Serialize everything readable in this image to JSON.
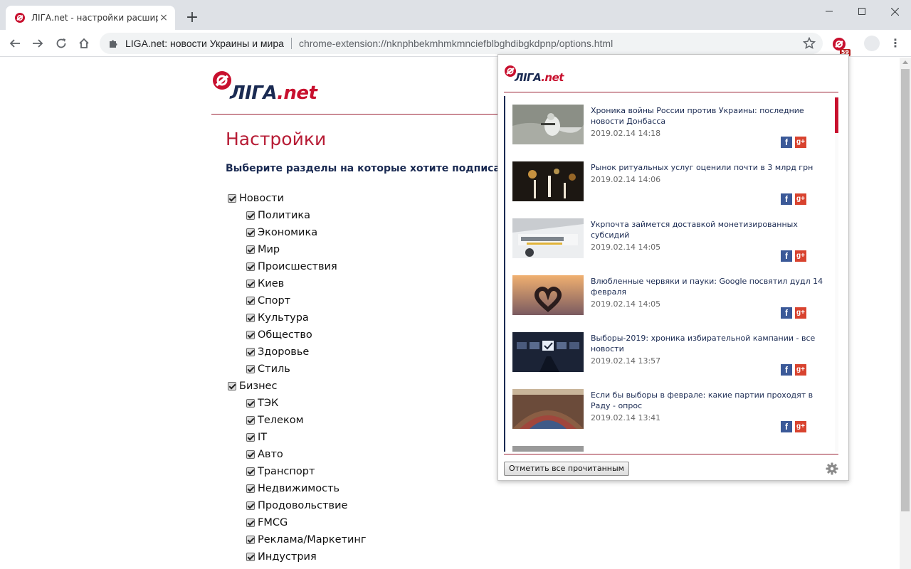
{
  "browser": {
    "tab_title": "ЛІГА.net - настройки расширения",
    "tab_close": "×",
    "new_tab": "+",
    "site_name": "LIGA.net: новости Украины и мира",
    "url": "chrome-extension://nknphbekmhmkmnciefblbghdibgkdpnp/options.html",
    "extension_badge": "59",
    "menu_glyph": "⋮",
    "brand_color": "#c8102e",
    "navy_color": "#1a2a52"
  },
  "logo": {
    "part1": "ЛІГА",
    "part2": ".net"
  },
  "page": {
    "title": "Настройки",
    "prompt": "Выберите разделы на которые хотите подписаться:",
    "sections": [
      {
        "label": "Новости",
        "checked": true,
        "children": [
          {
            "label": "Политика",
            "checked": true
          },
          {
            "label": "Экономика",
            "checked": true
          },
          {
            "label": "Мир",
            "checked": true
          },
          {
            "label": "Происшествия",
            "checked": true
          },
          {
            "label": "Киев",
            "checked": true
          },
          {
            "label": "Спорт",
            "checked": true
          },
          {
            "label": "Культура",
            "checked": true
          },
          {
            "label": "Общество",
            "checked": true
          },
          {
            "label": "Здоровье",
            "checked": true
          },
          {
            "label": "Стиль",
            "checked": true
          }
        ]
      },
      {
        "label": "Бизнес",
        "checked": true,
        "children": [
          {
            "label": "ТЭК",
            "checked": true
          },
          {
            "label": "Телеком",
            "checked": true
          },
          {
            "label": "IT",
            "checked": true
          },
          {
            "label": "Авто",
            "checked": true
          },
          {
            "label": "Транспорт",
            "checked": true
          },
          {
            "label": "Недвижимость",
            "checked": true
          },
          {
            "label": "Продовольствие",
            "checked": true
          },
          {
            "label": "FMCG",
            "checked": true
          },
          {
            "label": "Реклама/Маркетинг",
            "checked": true
          },
          {
            "label": "Индустрия",
            "checked": true
          }
        ]
      }
    ]
  },
  "popup": {
    "news": [
      {
        "title": "Хроника войны России против Украины: последние новости Донбасса",
        "time": "2019.02.14 14:18"
      },
      {
        "title": "Рынок ритуальных услуг оценили почти в 3 млрд грн",
        "time": "2019.02.14 14:06"
      },
      {
        "title": "Укрпочта займется доставкой монетизированных субсидий",
        "time": "2019.02.14 14:05"
      },
      {
        "title": "Влюбленные червяки и пауки: Google посвятил дудл 14 февраля",
        "time": "2019.02.14 14:05"
      },
      {
        "title": "Выборы-2019: хроника избирательной кампании - все новости",
        "time": "2019.02.14 13:57"
      },
      {
        "title": "Если бы выборы в феврале: какие партии проходят в Раду - опрос",
        "time": "2019.02.14 13:41"
      }
    ],
    "share_fb": "f",
    "share_gp": "g+",
    "mark_all_read": "Отметить все прочитанным"
  }
}
